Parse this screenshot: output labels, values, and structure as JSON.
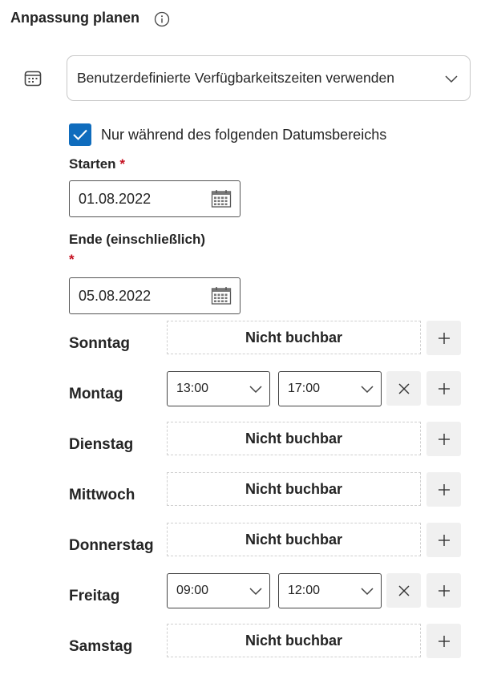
{
  "header": {
    "title": "Anpassung planen",
    "info_icon": "info-icon"
  },
  "schedule": {
    "icon": "calendar-icon",
    "selected_option": "Benutzerdefinierte Verfügbarkeitszeiten verwenden"
  },
  "date_range": {
    "checked": true,
    "checkbox_label": "Nur während des folgenden Datumsbereichs",
    "start_label": "Starten",
    "start_value": "01.08.2022",
    "end_label": "Ende (einschließlich)",
    "end_value": "05.08.2022",
    "required_marker": "*"
  },
  "days": [
    {
      "label": "Sonntag",
      "status": "Nicht buchbar"
    },
    {
      "label": "Montag",
      "start": "13:00",
      "end": "17:00"
    },
    {
      "label": "Dienstag",
      "status": "Nicht buchbar"
    },
    {
      "label": "Mittwoch",
      "status": "Nicht buchbar"
    },
    {
      "label": "Donnerstag",
      "status": "Nicht buchbar"
    },
    {
      "label": "Freitag",
      "start": "09:00",
      "end": "12:00"
    },
    {
      "label": "Samstag",
      "status": "Nicht buchbar"
    }
  ],
  "colors": {
    "accent": "#0f6cbd",
    "required": "#c50f1f",
    "button_bg": "#f0f0f0"
  }
}
